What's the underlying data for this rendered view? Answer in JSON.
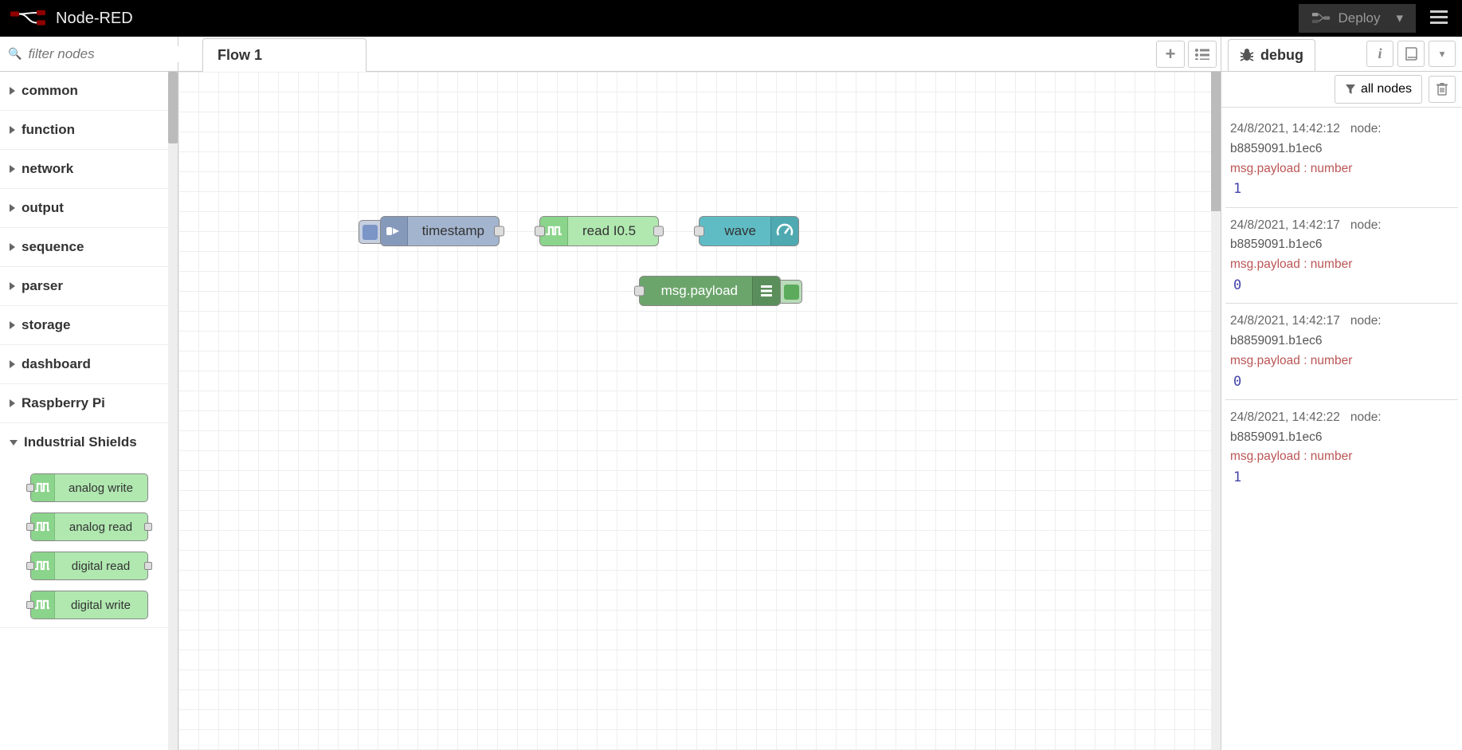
{
  "header": {
    "app_name": "Node-RED",
    "deploy_label": "Deploy"
  },
  "palette": {
    "filter_placeholder": "filter nodes",
    "categories": [
      {
        "label": "common",
        "expanded": false
      },
      {
        "label": "function",
        "expanded": false
      },
      {
        "label": "network",
        "expanded": false
      },
      {
        "label": "output",
        "expanded": false
      },
      {
        "label": "sequence",
        "expanded": false
      },
      {
        "label": "parser",
        "expanded": false
      },
      {
        "label": "storage",
        "expanded": false
      },
      {
        "label": "dashboard",
        "expanded": false
      },
      {
        "label": "Raspberry Pi",
        "expanded": false
      },
      {
        "label": "Industrial Shields",
        "expanded": true
      }
    ],
    "industrial_shields_nodes": [
      {
        "label": "analog write",
        "has_in": true,
        "has_out": false
      },
      {
        "label": "analog read",
        "has_in": true,
        "has_out": true
      },
      {
        "label": "digital read",
        "has_in": true,
        "has_out": true
      },
      {
        "label": "digital write",
        "has_in": true,
        "has_out": false
      }
    ]
  },
  "workspace": {
    "tabs": [
      {
        "label": "Flow 1"
      }
    ],
    "nodes": {
      "inject": {
        "label": "timestamp"
      },
      "read": {
        "label": "read I0.5"
      },
      "wave": {
        "label": "wave"
      },
      "debug": {
        "label": "msg.payload"
      }
    }
  },
  "sidebar": {
    "tab_label": "debug",
    "filter_label": "all nodes",
    "messages": [
      {
        "ts": "24/8/2021, 14:42:12",
        "node_prefix": "node:",
        "node_id": "b8859091.b1ec6",
        "path": "msg.payload : number",
        "value": "1"
      },
      {
        "ts": "24/8/2021, 14:42:17",
        "node_prefix": "node:",
        "node_id": "b8859091.b1ec6",
        "path": "msg.payload : number",
        "value": "0"
      },
      {
        "ts": "24/8/2021, 14:42:17",
        "node_prefix": "node:",
        "node_id": "b8859091.b1ec6",
        "path": "msg.payload : number",
        "value": "0"
      },
      {
        "ts": "24/8/2021, 14:42:22",
        "node_prefix": "node:",
        "node_id": "b8859091.b1ec6",
        "path": "msg.payload : number",
        "value": "1"
      }
    ]
  }
}
